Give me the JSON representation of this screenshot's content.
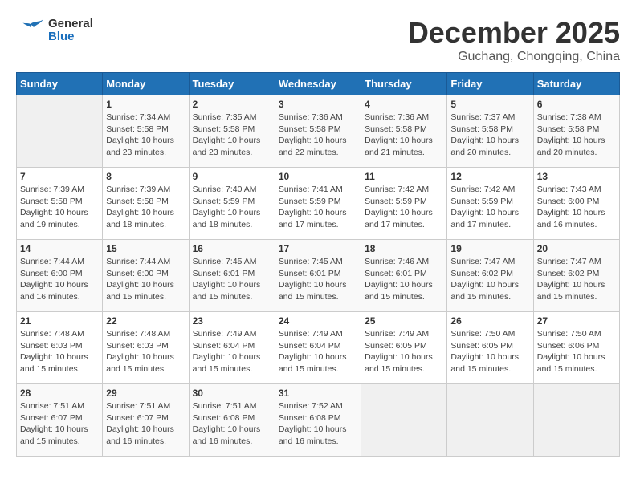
{
  "logo": {
    "general": "General",
    "blue": "Blue"
  },
  "title": "December 2025",
  "location": "Guchang, Chongqing, China",
  "days_header": [
    "Sunday",
    "Monday",
    "Tuesday",
    "Wednesday",
    "Thursday",
    "Friday",
    "Saturday"
  ],
  "weeks": [
    [
      {
        "day": "",
        "info": ""
      },
      {
        "day": "1",
        "info": "Sunrise: 7:34 AM\nSunset: 5:58 PM\nDaylight: 10 hours\nand 23 minutes."
      },
      {
        "day": "2",
        "info": "Sunrise: 7:35 AM\nSunset: 5:58 PM\nDaylight: 10 hours\nand 23 minutes."
      },
      {
        "day": "3",
        "info": "Sunrise: 7:36 AM\nSunset: 5:58 PM\nDaylight: 10 hours\nand 22 minutes."
      },
      {
        "day": "4",
        "info": "Sunrise: 7:36 AM\nSunset: 5:58 PM\nDaylight: 10 hours\nand 21 minutes."
      },
      {
        "day": "5",
        "info": "Sunrise: 7:37 AM\nSunset: 5:58 PM\nDaylight: 10 hours\nand 20 minutes."
      },
      {
        "day": "6",
        "info": "Sunrise: 7:38 AM\nSunset: 5:58 PM\nDaylight: 10 hours\nand 20 minutes."
      }
    ],
    [
      {
        "day": "7",
        "info": "Sunrise: 7:39 AM\nSunset: 5:58 PM\nDaylight: 10 hours\nand 19 minutes."
      },
      {
        "day": "8",
        "info": "Sunrise: 7:39 AM\nSunset: 5:58 PM\nDaylight: 10 hours\nand 18 minutes."
      },
      {
        "day": "9",
        "info": "Sunrise: 7:40 AM\nSunset: 5:59 PM\nDaylight: 10 hours\nand 18 minutes."
      },
      {
        "day": "10",
        "info": "Sunrise: 7:41 AM\nSunset: 5:59 PM\nDaylight: 10 hours\nand 17 minutes."
      },
      {
        "day": "11",
        "info": "Sunrise: 7:42 AM\nSunset: 5:59 PM\nDaylight: 10 hours\nand 17 minutes."
      },
      {
        "day": "12",
        "info": "Sunrise: 7:42 AM\nSunset: 5:59 PM\nDaylight: 10 hours\nand 17 minutes."
      },
      {
        "day": "13",
        "info": "Sunrise: 7:43 AM\nSunset: 6:00 PM\nDaylight: 10 hours\nand 16 minutes."
      }
    ],
    [
      {
        "day": "14",
        "info": "Sunrise: 7:44 AM\nSunset: 6:00 PM\nDaylight: 10 hours\nand 16 minutes."
      },
      {
        "day": "15",
        "info": "Sunrise: 7:44 AM\nSunset: 6:00 PM\nDaylight: 10 hours\nand 15 minutes."
      },
      {
        "day": "16",
        "info": "Sunrise: 7:45 AM\nSunset: 6:01 PM\nDaylight: 10 hours\nand 15 minutes."
      },
      {
        "day": "17",
        "info": "Sunrise: 7:45 AM\nSunset: 6:01 PM\nDaylight: 10 hours\nand 15 minutes."
      },
      {
        "day": "18",
        "info": "Sunrise: 7:46 AM\nSunset: 6:01 PM\nDaylight: 10 hours\nand 15 minutes."
      },
      {
        "day": "19",
        "info": "Sunrise: 7:47 AM\nSunset: 6:02 PM\nDaylight: 10 hours\nand 15 minutes."
      },
      {
        "day": "20",
        "info": "Sunrise: 7:47 AM\nSunset: 6:02 PM\nDaylight: 10 hours\nand 15 minutes."
      }
    ],
    [
      {
        "day": "21",
        "info": "Sunrise: 7:48 AM\nSunset: 6:03 PM\nDaylight: 10 hours\nand 15 minutes."
      },
      {
        "day": "22",
        "info": "Sunrise: 7:48 AM\nSunset: 6:03 PM\nDaylight: 10 hours\nand 15 minutes."
      },
      {
        "day": "23",
        "info": "Sunrise: 7:49 AM\nSunset: 6:04 PM\nDaylight: 10 hours\nand 15 minutes."
      },
      {
        "day": "24",
        "info": "Sunrise: 7:49 AM\nSunset: 6:04 PM\nDaylight: 10 hours\nand 15 minutes."
      },
      {
        "day": "25",
        "info": "Sunrise: 7:49 AM\nSunset: 6:05 PM\nDaylight: 10 hours\nand 15 minutes."
      },
      {
        "day": "26",
        "info": "Sunrise: 7:50 AM\nSunset: 6:05 PM\nDaylight: 10 hours\nand 15 minutes."
      },
      {
        "day": "27",
        "info": "Sunrise: 7:50 AM\nSunset: 6:06 PM\nDaylight: 10 hours\nand 15 minutes."
      }
    ],
    [
      {
        "day": "28",
        "info": "Sunrise: 7:51 AM\nSunset: 6:07 PM\nDaylight: 10 hours\nand 15 minutes."
      },
      {
        "day": "29",
        "info": "Sunrise: 7:51 AM\nSunset: 6:07 PM\nDaylight: 10 hours\nand 16 minutes."
      },
      {
        "day": "30",
        "info": "Sunrise: 7:51 AM\nSunset: 6:08 PM\nDaylight: 10 hours\nand 16 minutes."
      },
      {
        "day": "31",
        "info": "Sunrise: 7:52 AM\nSunset: 6:08 PM\nDaylight: 10 hours\nand 16 minutes."
      },
      {
        "day": "",
        "info": ""
      },
      {
        "day": "",
        "info": ""
      },
      {
        "day": "",
        "info": ""
      }
    ]
  ]
}
